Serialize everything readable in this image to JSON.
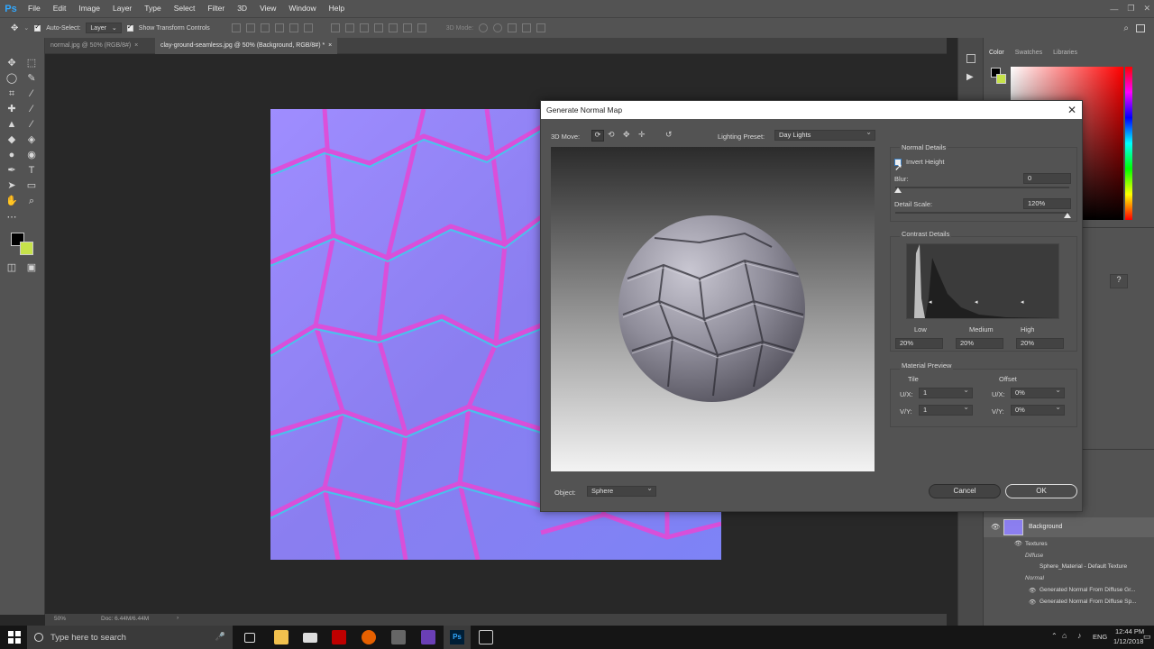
{
  "app": {
    "name": "Ps"
  },
  "menu": [
    "File",
    "Edit",
    "Image",
    "Layer",
    "Type",
    "Select",
    "Filter",
    "3D",
    "View",
    "Window",
    "Help"
  ],
  "options_bar": {
    "auto_select": "Auto-Select:",
    "layer_value": "Layer",
    "show_transform": "Show Transform Controls",
    "mode_3d": "3D Mode:"
  },
  "tabs": [
    {
      "label": "normal.jpg @ 50% (RGB/8#)",
      "close": "×"
    },
    {
      "label": "clay-ground-seamless.jpg @ 50% (Background, RGB/8#) *",
      "close": "×"
    }
  ],
  "status": {
    "zoom": "50%",
    "doc": "Doc: 6.44M/6.44M"
  },
  "right_panel": {
    "tabs": [
      "Color",
      "Swatches",
      "Libraries"
    ],
    "layers": {
      "background": "Background",
      "textures": "Textures",
      "diffuse": "Diffuse",
      "sphere_material": "Sphere_Material - Default Texture",
      "normal": "Normal",
      "gen1": "Generated Normal From Diffuse Gr...",
      "gen2": "Generated Normal From Diffuse Sp..."
    }
  },
  "dialog": {
    "title": "Generate Normal Map",
    "move_label": "3D Move:",
    "lighting_label": "Lighting Preset:",
    "lighting_value": "Day Lights",
    "normal_details": "Normal Details",
    "invert_height": "Invert Height",
    "blur_label": "Blur:",
    "blur_value": "0",
    "detail_scale_label": "Detail Scale:",
    "detail_scale_value": "120%",
    "contrast_details": "Contrast Details",
    "low": "Low",
    "medium": "Medium",
    "high": "High",
    "low_value": "20%",
    "medium_value": "20%",
    "high_value": "20%",
    "material_preview": "Material Preview",
    "tile": "Tile",
    "offset": "Offset",
    "ux_label": "U/X:",
    "vy_label": "V/Y:",
    "tile_ux": "1",
    "tile_vy": "1",
    "offset_ux": "0%",
    "offset_vy": "0%",
    "object_label": "Object:",
    "object_value": "Sphere",
    "cancel": "Cancel",
    "ok": "OK"
  },
  "taskbar": {
    "search_placeholder": "Type here to search",
    "time": "12:44 PM",
    "date": "1/12/2018",
    "lang": "ENG"
  },
  "colors": {
    "accent_blue": "#31a8ff",
    "texture_purple": "#8c7ff0",
    "foreground_swatch": "#000000",
    "background_swatch": "#c6e24a"
  }
}
